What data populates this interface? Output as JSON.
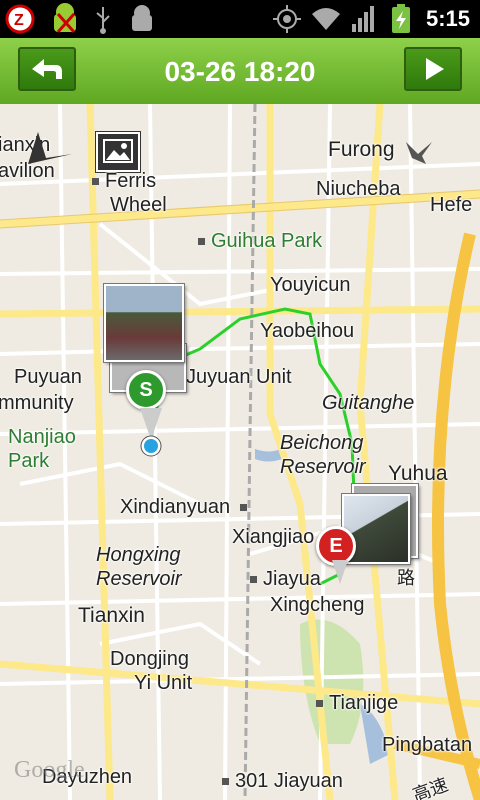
{
  "statusbar": {
    "time": "5:15",
    "icons": [
      "sms-alert-icon",
      "android-usb-icon",
      "usb-icon",
      "android-debug-icon",
      "gps-icon",
      "wifi-icon",
      "signal-icon",
      "battery-charging-icon"
    ]
  },
  "titlebar": {
    "title": "03-26 18:20",
    "back_icon": "back-arrow-icon",
    "next_icon": "play-forward-icon"
  },
  "map": {
    "labels": {
      "lianxin": "ianxin",
      "pavilion": "avilion",
      "ferris1": "Ferris",
      "ferris2": "Wheel",
      "furong": "Furong",
      "niucheba": "Niucheba",
      "hefe": "Hefe",
      "guihua": "Guihua Park",
      "youyicun": "Youyicun",
      "yaobeihou": "Yaobeihou",
      "puyuan": "Puyuan",
      "community": "mmunity",
      "juyuan": "Juyuan Unit",
      "guitanghe": "Guitanghe",
      "nanjiao1": "Nanjiao",
      "nanjiao2": "Park",
      "beichong1": "Beichong",
      "beichong2": "Reservoir",
      "yuhua": "Yuhua",
      "xindianyuan": "Xindianyuan",
      "xiangjiao": "Xiangjiao",
      "hongxing1": "Hongxing",
      "hongxing2": "Reservoir",
      "jiayua": "Jiayua",
      "xingcheng": "Xingcheng",
      "road_cn": "路",
      "tianxin": "Tianxin",
      "dongjing1": "Dongjing",
      "dongjing2": "Yi Unit",
      "tianjige": "Tianjige",
      "pingbatan": "Pingbatan",
      "dayuzhen": "Dayuzhen",
      "jiayuan301": "301 Jiayuan",
      "expressway_cn": "高速"
    },
    "markers": {
      "start": "S",
      "end": "E"
    },
    "watermark": "Google",
    "colors": {
      "track": "#2bd12b",
      "start_marker": "#2e9a2e",
      "end_marker": "#d32020",
      "highway": "#f6c342"
    }
  }
}
